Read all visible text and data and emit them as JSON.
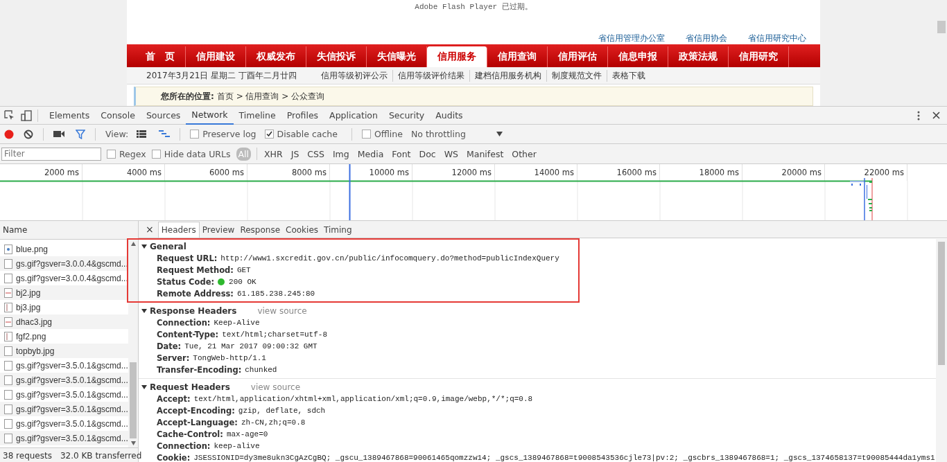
{
  "webpage": {
    "flash_notice": "Adobe Flash Player 已过期。",
    "top_links": [
      "省信用管理办公室",
      "省信用协会",
      "省信用研究中心"
    ],
    "nav": [
      {
        "label": "首　页",
        "selected": false
      },
      {
        "label": "信用建设",
        "selected": false
      },
      {
        "label": "权威发布",
        "selected": false
      },
      {
        "label": "失信投诉",
        "selected": false
      },
      {
        "label": "失信曝光",
        "selected": false
      },
      {
        "label": "信用服务",
        "selected": true
      },
      {
        "label": "信用查询",
        "selected": false
      },
      {
        "label": "信用评估",
        "selected": false
      },
      {
        "label": "信息申报",
        "selected": false
      },
      {
        "label": "政策法规",
        "selected": false
      },
      {
        "label": "信用研究",
        "selected": false
      }
    ],
    "date": "2017年3月21日  星期二  丁酉年二月廿四",
    "sub_links": [
      "信用等级初评公示",
      "信用等级评价结果",
      "建档信用服务机构",
      "制度规范文件",
      "表格下载"
    ],
    "breadcrumb": {
      "label": "您所在的位置:",
      "path": "首页 > 信用查询 > 公众查询"
    }
  },
  "devtools": {
    "tabs": [
      {
        "label": "Elements",
        "selected": false
      },
      {
        "label": "Console",
        "selected": false
      },
      {
        "label": "Sources",
        "selected": false
      },
      {
        "label": "Network",
        "selected": true
      },
      {
        "label": "Timeline",
        "selected": false
      },
      {
        "label": "Profiles",
        "selected": false
      },
      {
        "label": "Application",
        "selected": false
      },
      {
        "label": "Security",
        "selected": false
      },
      {
        "label": "Audits",
        "selected": false
      }
    ],
    "toolbar": {
      "recording": true,
      "view_label": "View:",
      "options": [
        {
          "label": "Preserve log",
          "checked": false
        },
        {
          "label": "Disable cache",
          "checked": true
        },
        {
          "label": "Offline",
          "checked": false
        }
      ],
      "throttling": "No throttling"
    },
    "filter": {
      "placeholder": "Filter",
      "options": [
        {
          "label": "Regex",
          "checked": false
        },
        {
          "label": "Hide data URLs",
          "checked": false
        }
      ],
      "types": [
        {
          "label": "All",
          "selected": true
        },
        {
          "label": "XHR",
          "selected": false
        },
        {
          "label": "JS",
          "selected": false
        },
        {
          "label": "CSS",
          "selected": false
        },
        {
          "label": "Img",
          "selected": false
        },
        {
          "label": "Media",
          "selected": false
        },
        {
          "label": "Font",
          "selected": false
        },
        {
          "label": "Doc",
          "selected": false
        },
        {
          "label": "WS",
          "selected": false
        },
        {
          "label": "Manifest",
          "selected": false
        },
        {
          "label": "Other",
          "selected": false
        }
      ]
    },
    "timeline": {
      "ticks": [
        "2000 ms",
        "4000 ms",
        "6000 ms",
        "8000 ms",
        "10000 ms",
        "12000 ms",
        "14000 ms",
        "16000 ms",
        "18000 ms",
        "20000 ms",
        "22000 ms"
      ]
    },
    "requests_header": "Name",
    "requests": [
      {
        "name": "blue.png",
        "kind": "dot"
      },
      {
        "name": "gs.gif?gsver=3.0.0.4&gscmd...",
        "kind": "blank"
      },
      {
        "name": "gs.gif?gsver=3.0.0.4&gscmd...",
        "kind": "blank"
      },
      {
        "name": "bj2.jpg",
        "kind": "stripe"
      },
      {
        "name": "bj3.jpg",
        "kind": "bar"
      },
      {
        "name": "dhac3.jpg",
        "kind": "stripe"
      },
      {
        "name": "fgf2.png",
        "kind": "bar"
      },
      {
        "name": "topbyb.jpg",
        "kind": "blank"
      },
      {
        "name": "gs.gif?gsver=3.5.0.1&gscmd...",
        "kind": "blank"
      },
      {
        "name": "gs.gif?gsver=3.5.0.1&gscmd...",
        "kind": "blank"
      },
      {
        "name": "gs.gif?gsver=3.5.0.1&gscmd...",
        "kind": "blank"
      },
      {
        "name": "gs.gif?gsver=3.5.0.1&gscmd...",
        "kind": "blank"
      },
      {
        "name": "gs.gif?gsver=3.5.0.1&gscmd...",
        "kind": "blank"
      },
      {
        "name": "gs.gif?gsver=3.5.0.1&gscmd...",
        "kind": "blank"
      }
    ],
    "status": [
      "38 requests",
      "32.0 KB transferred"
    ],
    "detail_close": "×",
    "detail_tabs": [
      {
        "label": "Headers",
        "selected": true
      },
      {
        "label": "Preview",
        "selected": false
      },
      {
        "label": "Response",
        "selected": false
      },
      {
        "label": "Cookies",
        "selected": false
      },
      {
        "label": "Timing",
        "selected": false
      }
    ],
    "sections": [
      {
        "title": "General",
        "expanded": true,
        "highlighted": true,
        "rows": [
          {
            "name": "Request URL:",
            "value": "http://www1.sxcredit.gov.cn/public/infocomquery.do?method=publicIndexQuery",
            "kind": "plain"
          },
          {
            "name": "Request Method:",
            "value": "GET",
            "kind": "plain"
          },
          {
            "name": "Status Code:",
            "value": "200 OK",
            "kind": "status"
          },
          {
            "name": "Remote Address:",
            "value": "61.185.238.245:80",
            "kind": "plain"
          }
        ]
      },
      {
        "title": "Response Headers",
        "expanded": true,
        "highlighted": false,
        "link": "view source",
        "rows": [
          {
            "name": "Connection:",
            "value": "Keep-Alive",
            "kind": "plain"
          },
          {
            "name": "Content-Type:",
            "value": "text/html;charset=utf-8",
            "kind": "plain"
          },
          {
            "name": "Date:",
            "value": "Tue, 21 Mar 2017 09:00:32 GMT",
            "kind": "plain"
          },
          {
            "name": "Server:",
            "value": "TongWeb-http/1.1",
            "kind": "plain"
          },
          {
            "name": "Transfer-Encoding:",
            "value": "chunked",
            "kind": "plain"
          }
        ]
      },
      {
        "title": "Request Headers",
        "expanded": true,
        "highlighted": false,
        "link": "view source",
        "rows": [
          {
            "name": "Accept:",
            "value": "text/html,application/xhtml+xml,application/xml;q=0.9,image/webp,*/*;q=0.8",
            "kind": "plain"
          },
          {
            "name": "Accept-Encoding:",
            "value": "gzip, deflate, sdch",
            "kind": "plain"
          },
          {
            "name": "Accept-Language:",
            "value": "zh-CN,zh;q=0.8",
            "kind": "plain"
          },
          {
            "name": "Cache-Control:",
            "value": "max-age=0",
            "kind": "plain"
          },
          {
            "name": "Connection:",
            "value": "keep-alive",
            "kind": "plain"
          },
          {
            "name": "Cookie:",
            "value": "JSESSIONID=dy3me8ukn3CgAzCgBQ; _gscu_1389467868=90061465qomzzw14; _gscs_1389467868=t9008543536cjle73|pv:2; _gscbrs_1389467868=1; _gscs_1374658137=t90085444da1yms1",
            "kind": "plain"
          }
        ]
      }
    ]
  }
}
